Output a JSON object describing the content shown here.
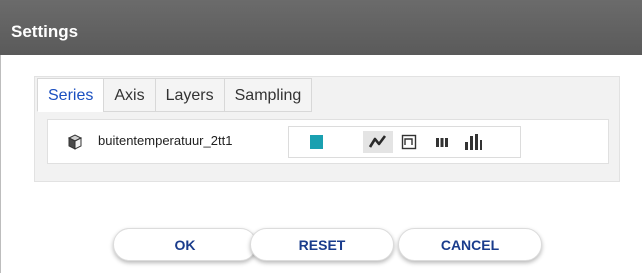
{
  "dialog": {
    "title": "Settings"
  },
  "tabs": [
    {
      "label": "Series",
      "active": true
    },
    {
      "label": "Axis",
      "active": false
    },
    {
      "label": "Layers",
      "active": false
    },
    {
      "label": "Sampling",
      "active": false
    }
  ],
  "series": {
    "name": "buitentemperatuur_2tt1",
    "icon": "cube-icon",
    "color": "#1aa0b0",
    "chart_types": [
      {
        "icon": "line-chart-icon",
        "selected": true
      },
      {
        "icon": "step-chart-icon",
        "selected": false
      },
      {
        "icon": "bar-chart-icon",
        "selected": false
      },
      {
        "icon": "column-chart-icon",
        "selected": false
      }
    ]
  },
  "buttons": {
    "ok": "OK",
    "reset": "RESET",
    "cancel": "CANCEL"
  },
  "colors": {
    "titlebar": "#5f5f5f",
    "accent_text": "#1a3c8c",
    "active_tab": "#1a4fc0"
  }
}
